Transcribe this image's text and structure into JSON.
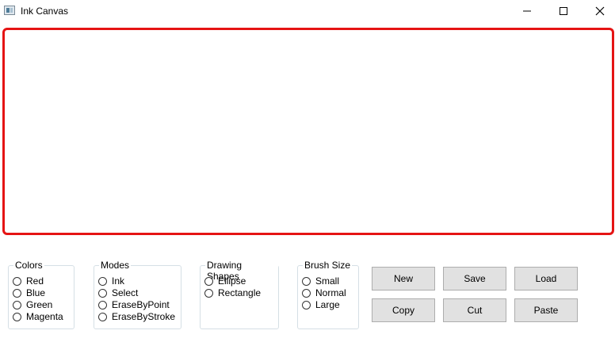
{
  "window": {
    "title": "Ink Canvas",
    "icon": "ink-canvas-app-icon"
  },
  "window_controls": [
    "minimize-icon",
    "maximize-icon",
    "close-icon"
  ],
  "canvas": {
    "border_color": "#e51414"
  },
  "groups": {
    "colors": {
      "legend": "Colors",
      "options": [
        "Red",
        "Blue",
        "Green",
        "Magenta"
      ]
    },
    "modes": {
      "legend": "Modes",
      "options": [
        "Ink",
        "Select",
        "EraseByPoint",
        "EraseByStroke"
      ]
    },
    "shapes": {
      "legend": "Drawing Shapes",
      "options": [
        "Ellipse",
        "Rectangle"
      ]
    },
    "brush": {
      "legend": "Brush Size",
      "options": [
        "Small",
        "Normal",
        "Large"
      ]
    }
  },
  "buttons": {
    "new": "New",
    "save": "Save",
    "load": "Load",
    "copy": "Copy",
    "cut": "Cut",
    "paste": "Paste"
  }
}
